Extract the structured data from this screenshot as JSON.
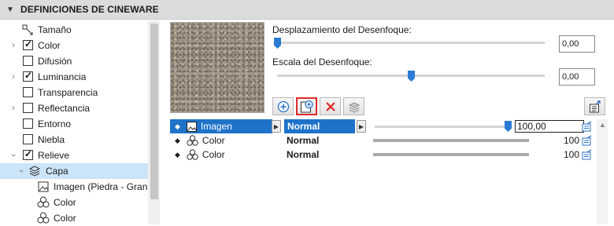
{
  "header": {
    "title": "DEFINICIONES DE CINEWARE"
  },
  "tree": {
    "items": [
      {
        "label": "Tamaño",
        "icon": "size-arrows-icon",
        "checkbox": false,
        "expander": false
      },
      {
        "label": "Color",
        "checked": true,
        "checkbox": true,
        "expander": true
      },
      {
        "label": "Difusión",
        "checked": false,
        "checkbox": true,
        "expander": false
      },
      {
        "label": "Luminancia",
        "checked": true,
        "checkbox": true,
        "expander": true
      },
      {
        "label": "Transparencia",
        "checked": false,
        "checkbox": true,
        "expander": false
      },
      {
        "label": "Reflectancia",
        "checked": false,
        "checkbox": true,
        "expander": true
      },
      {
        "label": "Entorno",
        "checked": false,
        "checkbox": true,
        "expander": false
      },
      {
        "label": "Niebla",
        "checked": false,
        "checkbox": true,
        "expander": false
      },
      {
        "label": "Relieve",
        "checked": true,
        "checkbox": true,
        "expander": true,
        "expanded": true
      },
      {
        "label": "Capa",
        "icon": "layers-icon",
        "expanded": true,
        "selected": true
      },
      {
        "label": "Imagen (Piedra - Granito",
        "icon": "image-icon"
      },
      {
        "label": "Color",
        "icon": "color-channels-icon"
      },
      {
        "label": "Color",
        "icon": "color-channels-icon"
      }
    ]
  },
  "sliders": {
    "blur_offset": {
      "label": "Desplazamiento del Desenfoque:",
      "value": "0,00",
      "fraction": 0.0
    },
    "blur_scale": {
      "label": "Escala del Desenfoque:",
      "value": "0,00",
      "fraction": 0.5
    }
  },
  "toolbar": {
    "buttons": [
      "add-shader-icon",
      "add-image-icon",
      "delete-icon",
      "folder-layers-icon"
    ],
    "right_button": "export-icon"
  },
  "layers": {
    "rows": [
      {
        "name": "Imagen",
        "icon": "image-icon",
        "mode": "Normal",
        "value": "100,00",
        "fraction": 1.0,
        "selected": true
      },
      {
        "name": "Color",
        "icon": "color-channels-icon",
        "mode": "Normal",
        "value": "100",
        "fraction": 1.0,
        "selected": false
      },
      {
        "name": "Color",
        "icon": "color-channels-icon",
        "mode": "Normal",
        "value": "100",
        "fraction": 1.0,
        "selected": false
      }
    ]
  },
  "colors": {
    "accent": "#1e73c9",
    "selection": "#cce4f7",
    "highlight_border": "#e0282a"
  }
}
